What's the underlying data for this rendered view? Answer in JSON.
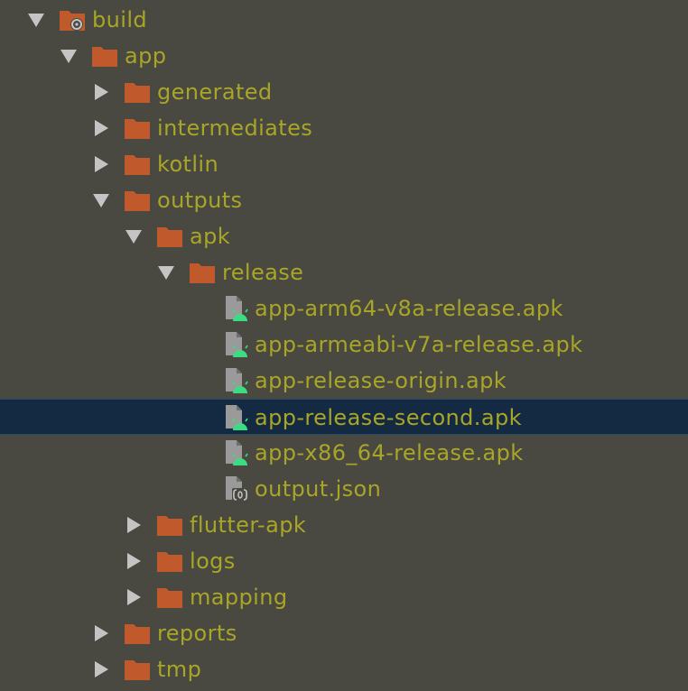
{
  "colors": {
    "background": "#494841",
    "text": "#a9a627",
    "folder": "#c05a2c",
    "selection": "#142a42",
    "android": "#3ddc84",
    "file": "#9a9a9a"
  },
  "tree": {
    "build": "build",
    "app": "app",
    "generated": "generated",
    "intermediates": "intermediates",
    "kotlin": "kotlin",
    "outputs": "outputs",
    "apk": "apk",
    "release": "release",
    "file_arm64": "app-arm64-v8a-release.apk",
    "file_armeabi": "app-armeabi-v7a-release.apk",
    "file_origin": "app-release-origin.apk",
    "file_second": "app-release-second.apk",
    "file_x86": "app-x86_64-release.apk",
    "file_output_json": "output.json",
    "flutter_apk": "flutter-apk",
    "logs": "logs",
    "mapping": "mapping",
    "reports": "reports",
    "tmp": "tmp"
  },
  "selected_item": "app-release-second.apk",
  "icons": {
    "expanded": "triangle-down-icon",
    "collapsed": "triangle-right-icon",
    "folder": "folder-icon",
    "build_folder": "build-folder-icon",
    "apk": "android-apk-icon",
    "json": "json-file-icon"
  }
}
